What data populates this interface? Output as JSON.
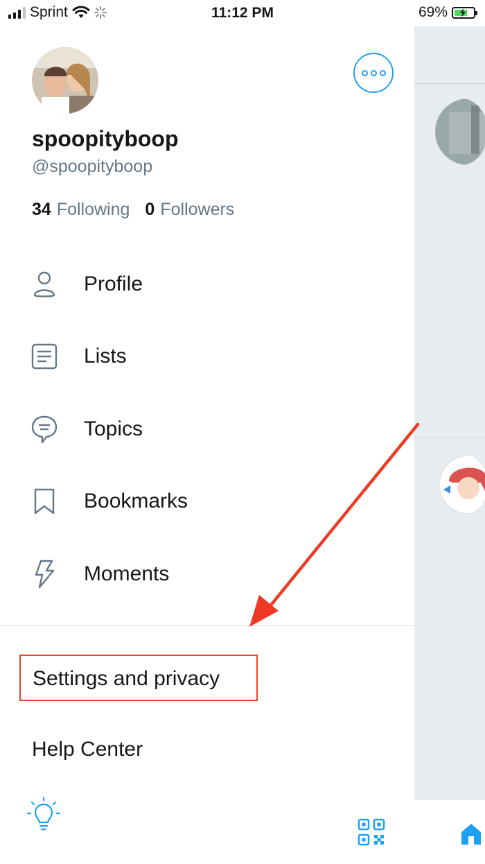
{
  "status_bar": {
    "carrier": "Sprint",
    "time": "11:12 PM",
    "battery_percent": "69%",
    "battery_level": 0.69
  },
  "profile": {
    "display_name": "spoopityboop",
    "handle": "@spoopityboop",
    "following_count": "34",
    "following_label": "Following",
    "followers_count": "0",
    "followers_label": "Followers"
  },
  "menu": {
    "items": [
      {
        "label": "Profile",
        "icon": "person-icon"
      },
      {
        "label": "Lists",
        "icon": "list-icon"
      },
      {
        "label": "Topics",
        "icon": "topics-icon"
      },
      {
        "label": "Bookmarks",
        "icon": "bookmark-icon"
      },
      {
        "label": "Moments",
        "icon": "lightning-icon"
      }
    ],
    "settings_label": "Settings and privacy",
    "help_label": "Help Center"
  },
  "colors": {
    "accent": "#1da1f2",
    "highlight_box": "#e8442a",
    "arrow": "#ee3a24",
    "secondary_text": "#657786"
  }
}
